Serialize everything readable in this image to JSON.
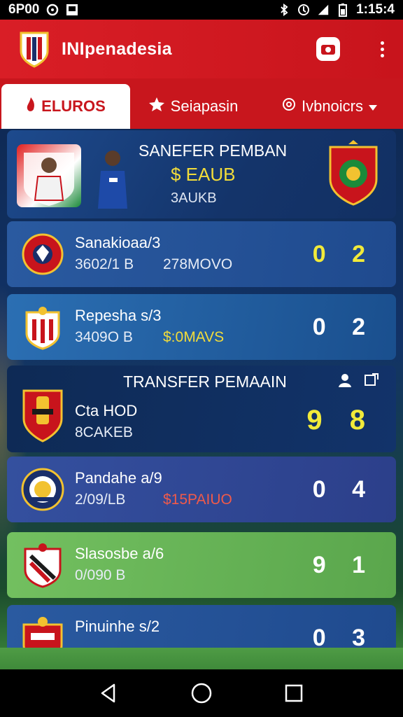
{
  "status_bar": {
    "left_text": "6P00",
    "time": "1:15:4",
    "icons": [
      "whatsapp-icon",
      "image-icon",
      "bluetooth-icon",
      "vibrate-icon",
      "signal-icon",
      "battery-icon"
    ]
  },
  "app_bar": {
    "title": "INIpenadesia",
    "icons": [
      "club-crest-icon",
      "camera-icon",
      "more-vert-icon"
    ]
  },
  "tabs": [
    {
      "label": "ELUROS",
      "icon": "fire-icon",
      "active": true
    },
    {
      "label": "Seiapasin",
      "icon": "star-icon",
      "active": false
    },
    {
      "label": "Ivbnoicrs",
      "icon": "at-icon",
      "dropdown": true,
      "active": false
    }
  ],
  "hero": {
    "title": "SANEFER PEMBAN",
    "price": "$ EAUB",
    "sub": "3AUKB"
  },
  "cards": [
    {
      "name": "Sanakioaa/3",
      "fee": "3602/1 B",
      "value": "278MOVO",
      "score": "0 2",
      "score_color": "#f1ea3a"
    },
    {
      "name": "Repesha s/3",
      "fee": "3409O B",
      "value": "$:0MAVS",
      "score": "0 2",
      "score_color": "#ffffff"
    },
    {
      "section_title": "TRANSFER PEMAAIN",
      "name": "Cta HOD",
      "fee": "8CAKEB",
      "score": "9 8",
      "score_color": "#f1ea3a"
    },
    {
      "name": "Pandahe a/9",
      "fee": "2/09/LB",
      "value": "$15PAIUO",
      "score": "0 4",
      "score_color": "#ffffff"
    },
    {
      "name": "Slasosbe a/6",
      "fee": "0/090 B",
      "score": "9 1",
      "score_color": "#ffffff"
    },
    {
      "name": "Pinuinhe s/2",
      "score": "0 3",
      "score_color": "#ffffff"
    }
  ],
  "colors": {
    "primary_red": "#d91e26",
    "accent_yellow": "#f1ea3a",
    "value_red": "#f05a4a",
    "hero_price_yellow": "#f2dc3a"
  },
  "nav": [
    "back-icon",
    "home-icon",
    "recents-icon"
  ]
}
